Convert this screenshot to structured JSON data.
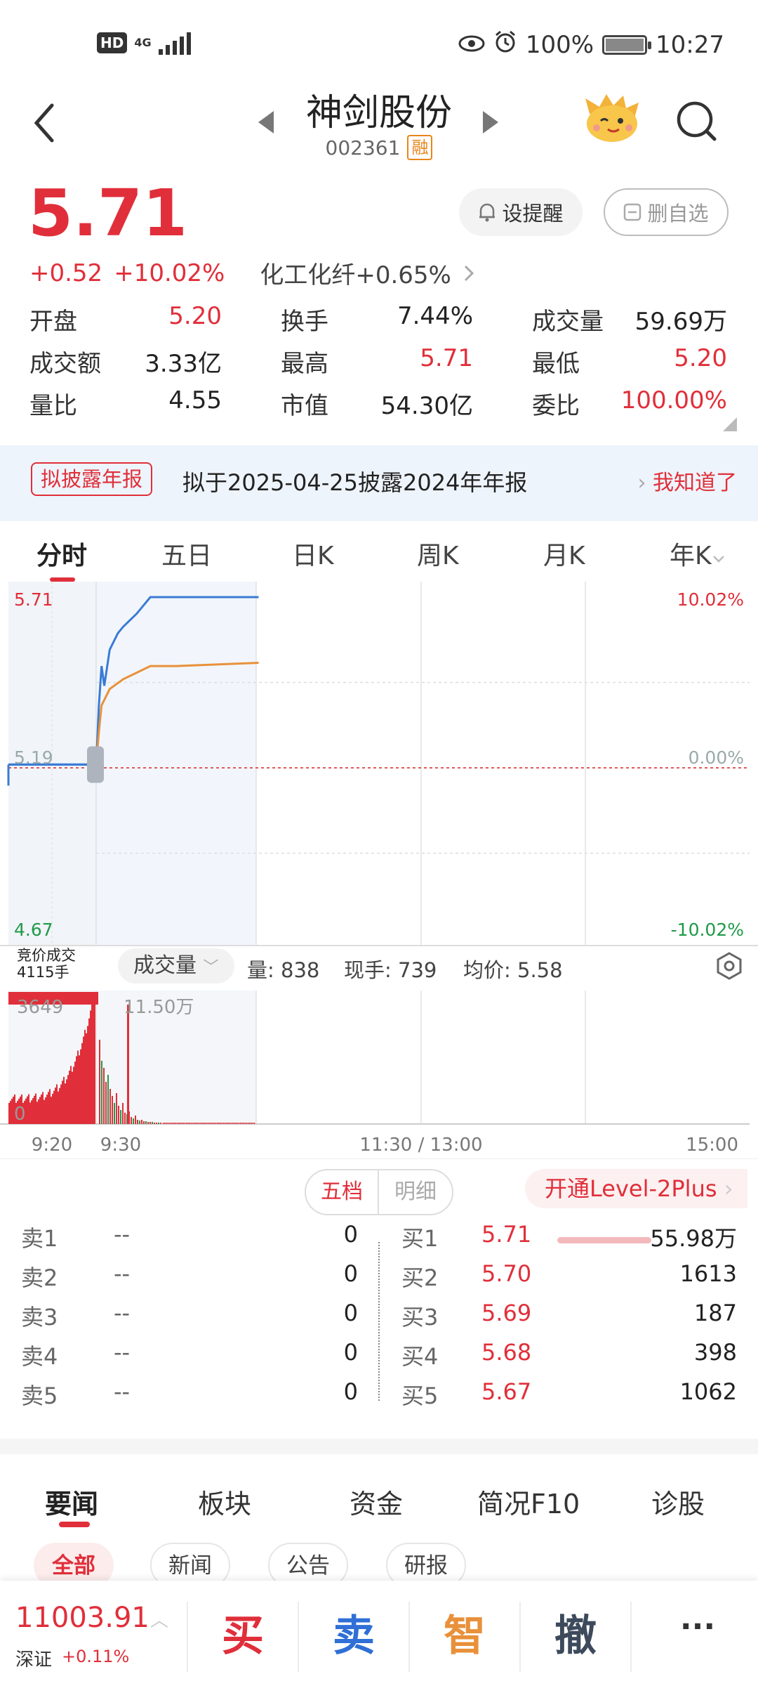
{
  "status_bar": {
    "network": "4G",
    "hd": "HD",
    "battery": "100%",
    "time": "10:27",
    "icons": [
      "eye-icon",
      "alarm-icon",
      "battery-icon",
      "signal-icon"
    ]
  },
  "header": {
    "stock_name": "神剑股份",
    "stock_code": "002361",
    "margin_badge": "融"
  },
  "quote": {
    "price": "5.71",
    "change": "+0.52",
    "change_pct": "+10.02%",
    "sector_name": "化工化纤",
    "sector_change": "+0.65%",
    "alert_label": "设提醒",
    "remove_label": "删自选"
  },
  "stats": [
    {
      "label": "开盘",
      "value": "5.20",
      "color": "#e02f3a"
    },
    {
      "label": "换手",
      "value": "7.44%",
      "color": "#222222"
    },
    {
      "label": "成交量",
      "value": "59.69万",
      "color": "#222222"
    },
    {
      "label": "成交额",
      "value": "3.33亿",
      "color": "#222222"
    },
    {
      "label": "最高",
      "value": "5.71",
      "color": "#e02f3a"
    },
    {
      "label": "最低",
      "value": "5.20",
      "color": "#e02f3a"
    },
    {
      "label": "量比",
      "value": "4.55",
      "color": "#222222"
    },
    {
      "label": "市值",
      "value": "54.30亿",
      "color": "#222222"
    },
    {
      "label": "委比",
      "value": "100.00%",
      "color": "#e02f3a"
    }
  ],
  "banner": {
    "tag": "拟披露年报",
    "text": "拟于2025-04-25披露2024年年报",
    "action": "我知道了"
  },
  "period_tabs": [
    "分时",
    "五日",
    "日K",
    "周K",
    "月K",
    "年K"
  ],
  "chart": {
    "price_top": "5.71",
    "price_mid": "5.19",
    "price_bottom": "4.67",
    "pct_top": "10.02%",
    "pct_mid": "0.00%",
    "pct_bottom": "-10.02%",
    "time_labels": [
      "9:20",
      "9:30",
      "11:30 / 13:00",
      "15:00"
    ],
    "vol_axis_top": "3649",
    "vol_axis_zero": "0",
    "vol_peak_label": "11.50万",
    "colors": {
      "price_line": "#3a7bd5",
      "avg_line": "#e8913a",
      "up": "#e02f3a",
      "down": "#1f9a48"
    }
  },
  "chart_data": {
    "type": "line",
    "title": "",
    "xlabel": "",
    "ylabel": "",
    "ylim": [
      4.67,
      5.71
    ],
    "prev_close": 5.19,
    "x_range": [
      "9:15",
      "15:00"
    ],
    "series": [
      {
        "x": [
          "9:15",
          "9:25",
          "9:30",
          "9:31",
          "9:32",
          "9:33",
          "9:35",
          "9:38",
          "9:40",
          "9:45",
          "9:50",
          "10:00",
          "10:30"
        ],
        "values": [
          5.2,
          5.2,
          5.2,
          5.38,
          5.5,
          5.44,
          5.55,
          5.6,
          5.62,
          5.66,
          5.71,
          5.71,
          5.71
        ]
      },
      {
        "x": [
          "9:30",
          "9:31",
          "9:32",
          "9:35",
          "9:40",
          "9:45",
          "9:50",
          "10:00",
          "10:30"
        ],
        "values": [
          5.2,
          5.3,
          5.38,
          5.43,
          5.46,
          5.48,
          5.5,
          5.5,
          5.51
        ]
      }
    ]
  },
  "volume_header": {
    "auction_line1": "竞价成交",
    "auction_line2": "4115手",
    "selector": "成交量",
    "qty_label": "量: 838",
    "hand_label": "现手: 739",
    "avg_label": "均价: 5.58"
  },
  "order_book": {
    "tab_five": "五档",
    "tab_detail": "明细",
    "level2": "开通Level-2Plus",
    "asks": [
      {
        "label": "卖1",
        "price": "--",
        "vol": "0"
      },
      {
        "label": "卖2",
        "price": "--",
        "vol": "0"
      },
      {
        "label": "卖3",
        "price": "--",
        "vol": "0"
      },
      {
        "label": "卖4",
        "price": "--",
        "vol": "0"
      },
      {
        "label": "卖5",
        "price": "--",
        "vol": "0"
      }
    ],
    "bids": [
      {
        "label": "买1",
        "price": "5.71",
        "vol": "55.98万"
      },
      {
        "label": "买2",
        "price": "5.70",
        "vol": "1613"
      },
      {
        "label": "买3",
        "price": "5.69",
        "vol": "187"
      },
      {
        "label": "买4",
        "price": "5.68",
        "vol": "398"
      },
      {
        "label": "买5",
        "price": "5.67",
        "vol": "1062"
      }
    ]
  },
  "news_tabs": [
    "要闻",
    "板块",
    "资金",
    "简况F10",
    "诊股"
  ],
  "news_chips": [
    "全部",
    "新闻",
    "公告",
    "研报"
  ],
  "bottom_bar": {
    "index_value": "11003.91",
    "index_name": "深证",
    "index_change": "+0.11%",
    "buy": "买",
    "sell": "卖",
    "smart": "智",
    "cancel": "撤",
    "more": "···"
  }
}
